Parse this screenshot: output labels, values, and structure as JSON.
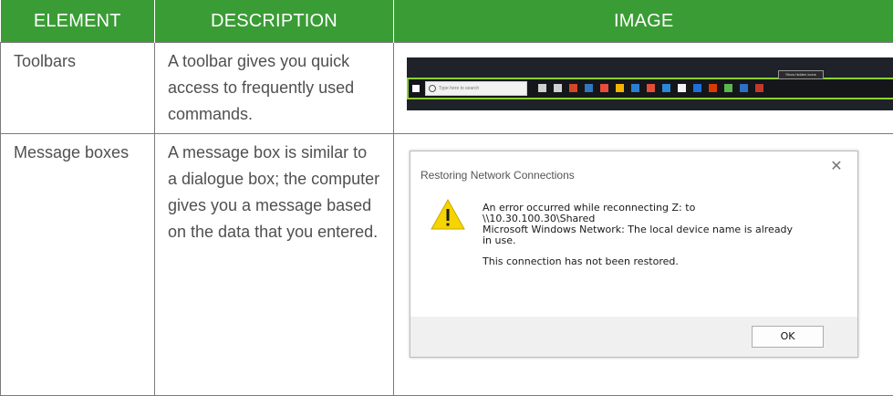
{
  "table": {
    "headers": [
      "ELEMENT",
      "DESCRIPTION",
      "IMAGE"
    ],
    "rows": [
      {
        "element": "Toolbars",
        "description": "A toolbar gives you quick access to frequently used commands."
      },
      {
        "element": "Message boxes",
        "description": "A message box is similar to a dialogue box; the computer gives you a message based on the data that you entered."
      }
    ]
  },
  "taskbar": {
    "search_placeholder": "Type here to search",
    "tooltip": "Show hidden icons",
    "accent_color": "#8bd12b",
    "icons": [
      {
        "name": "mic-icon",
        "color": "#cfcfcf"
      },
      {
        "name": "task-view-icon",
        "color": "#cfcfcf"
      },
      {
        "name": "app-icon-1",
        "color": "#d24726"
      },
      {
        "name": "edge-icon",
        "color": "#3277bc"
      },
      {
        "name": "app-icon-2",
        "color": "#e74c3c"
      },
      {
        "name": "chrome-icon",
        "color": "#f4b400"
      },
      {
        "name": "app-icon-3",
        "color": "#2d7dd2"
      },
      {
        "name": "app-icon-4",
        "color": "#e04e39"
      },
      {
        "name": "app-icon-5",
        "color": "#2b88d8"
      },
      {
        "name": "app-icon-6",
        "color": "#f2f2f2"
      },
      {
        "name": "app-icon-7",
        "color": "#1e6fd9"
      },
      {
        "name": "app-icon-8",
        "color": "#d83b01"
      },
      {
        "name": "app-icon-9",
        "color": "#5bb74d"
      },
      {
        "name": "app-icon-10",
        "color": "#2e6ec7"
      },
      {
        "name": "app-icon-11",
        "color": "#c0392b"
      }
    ]
  },
  "dialog": {
    "title": "Restoring Network Connections",
    "close_glyph": "✕",
    "message_lines": [
      "An error occurred while reconnecting Z: to",
      "\\\\10.30.100.30\\Shared",
      "Microsoft Windows Network: The local device name is already",
      "in use."
    ],
    "status": "This connection has not been restored.",
    "ok_label": "OK",
    "warning_icon": "warning-icon"
  }
}
